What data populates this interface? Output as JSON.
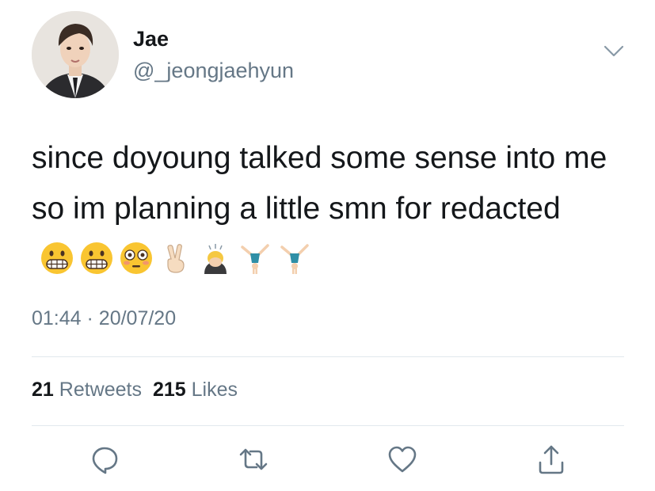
{
  "author": {
    "display_name": "Jae",
    "handle": "@_jeongjaehyun"
  },
  "tweet": {
    "text": "since doyoung talked some sense into me so im planning a little smn for redacted",
    "emojis": [
      "grimacing-face-icon",
      "grimacing-face-icon",
      "flushed-face-icon",
      "victory-hand-icon",
      "person-bowing-icon",
      "person-cartwheeling-icon",
      "person-cartwheeling-icon"
    ]
  },
  "meta": {
    "time": "01:44",
    "separator": "·",
    "date": "20/07/20"
  },
  "stats": {
    "retweets_count": "21",
    "retweets_label": "Retweets",
    "likes_count": "215",
    "likes_label": "Likes"
  },
  "icons": {
    "more": "chevron-down-icon",
    "reply": "reply-icon",
    "retweet": "retweet-icon",
    "like": "heart-icon",
    "share": "share-icon"
  },
  "colors": {
    "text_primary": "#14171a",
    "text_secondary": "#657786",
    "divider": "#e1e8ed"
  }
}
